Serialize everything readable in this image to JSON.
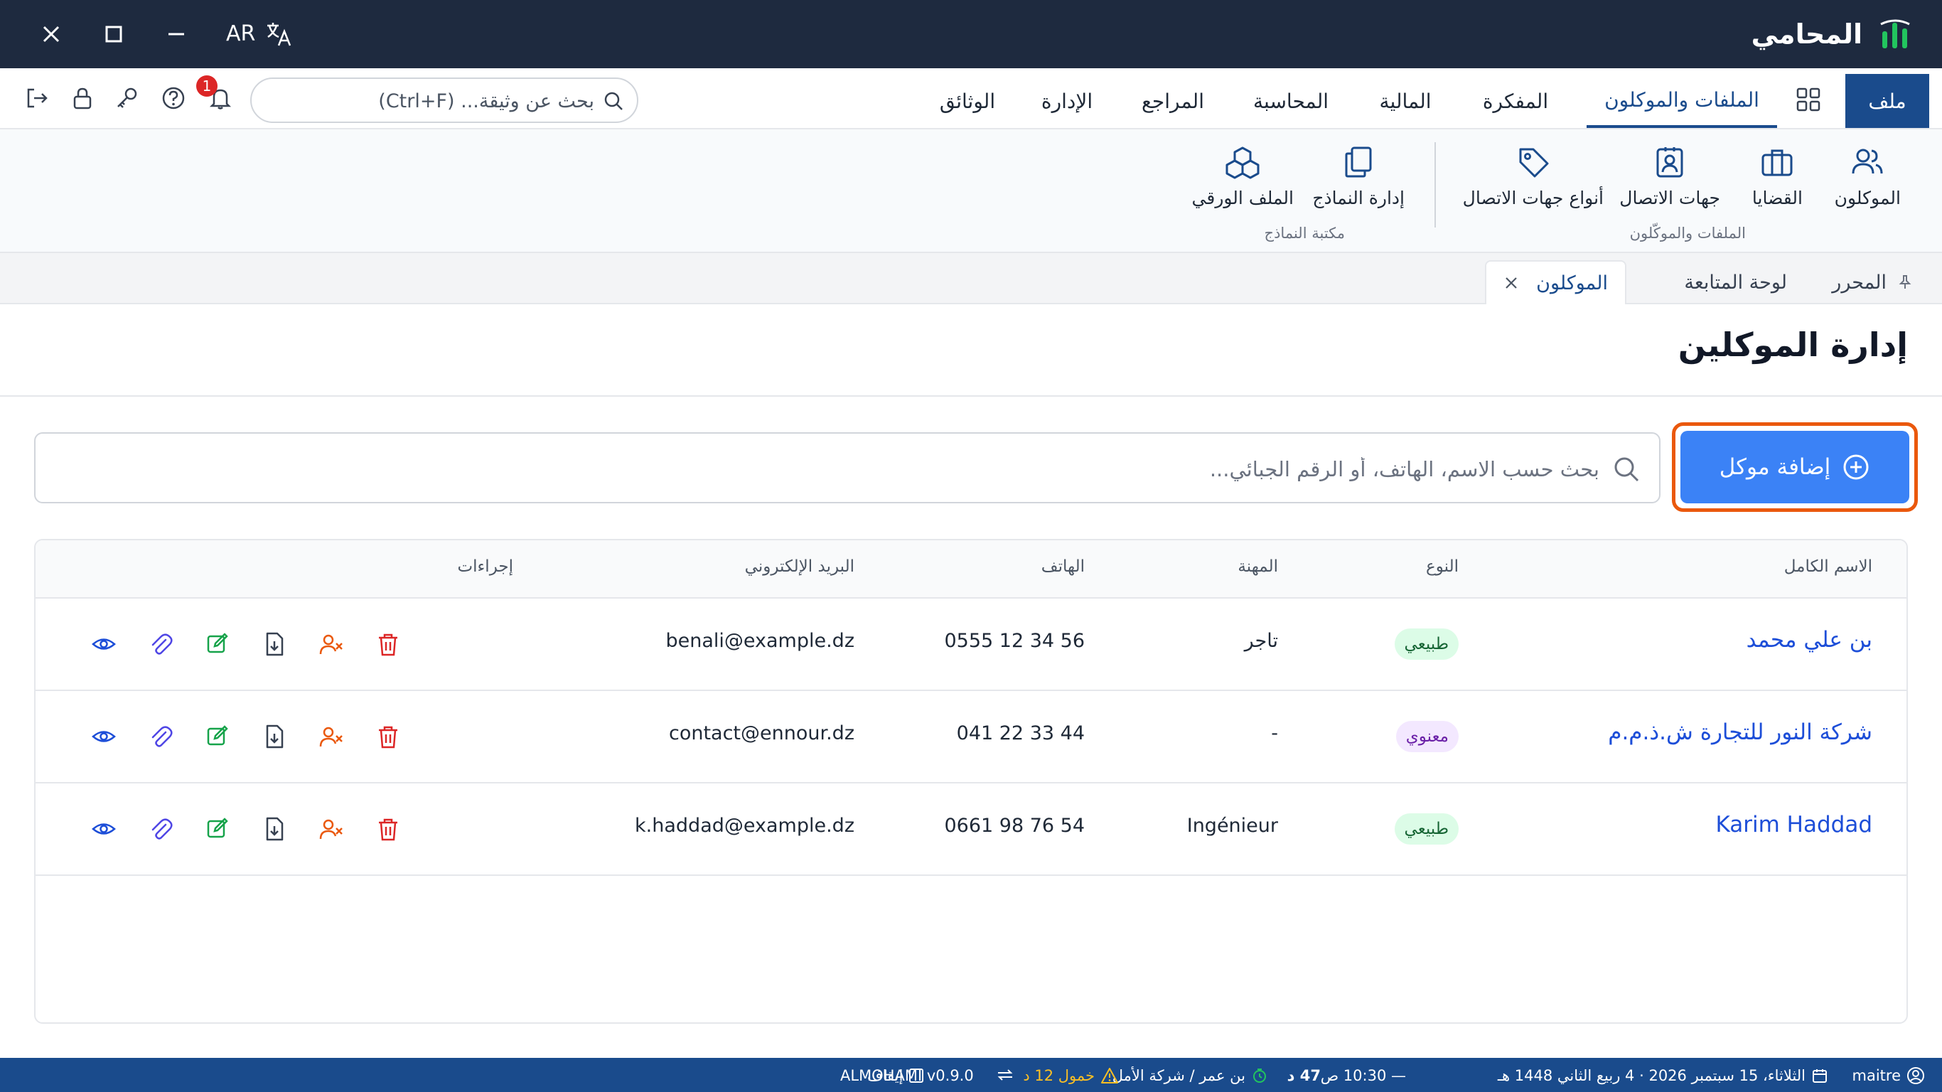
{
  "window": {
    "app_name": "المحامي",
    "lang_code": "AR"
  },
  "menu": {
    "file": "ملف",
    "tabs": [
      "الملفات والموكلون",
      "المفكرة",
      "المالية",
      "المحاسبة",
      "المراجع",
      "الإدارة",
      "الوثائق"
    ],
    "active_tab": "الملفات والموكلون",
    "search_placeholder": "بحث عن وثيقة... (Ctrl+F)",
    "notification_count": "1"
  },
  "ribbon": {
    "groups": [
      {
        "label": "الملفات والموكّلون",
        "items": [
          {
            "label": "الموكلون",
            "icon": "users-icon"
          },
          {
            "label": "القضايا",
            "icon": "briefcase-icon"
          },
          {
            "label": "جهات الاتصال",
            "icon": "contact-icon"
          },
          {
            "label": "أنواع جهات الاتصال",
            "icon": "tag-icon"
          }
        ]
      },
      {
        "label": "مكتبة النماذج",
        "items": [
          {
            "label": "إدارة النماذج",
            "icon": "copy-icon"
          },
          {
            "label": "الملف الورقي",
            "icon": "boxes-icon"
          }
        ]
      }
    ]
  },
  "doc_tabs": {
    "pinned": "المحرر",
    "dashboard": "لوحة المتابعة",
    "active": "الموكلون"
  },
  "page": {
    "title": "إدارة الموكلين",
    "add_button": "إضافة موكل",
    "search_placeholder": "بحث حسب الاسم، الهاتف، أو الرقم الجبائي..."
  },
  "table": {
    "headers": {
      "name": "الاسم الكامل",
      "type": "النوع",
      "profession": "المهنة",
      "phone": "الهاتف",
      "email": "البريد الإلكتروني",
      "actions": "إجراءات"
    },
    "rows": [
      {
        "name": "بن علي محمد",
        "type": "طبيعي",
        "type_kind": "natural",
        "profession": "تاجر",
        "phone": "0555 12 34 56",
        "email": "benali@example.dz"
      },
      {
        "name": "شركة النور للتجارة ش.ذ.م.م",
        "type": "معنوي",
        "type_kind": "moral",
        "profession": "-",
        "phone": "041 22 33 44",
        "email": "contact@ennour.dz"
      },
      {
        "name": "Karim Haddad",
        "type": "طبيعي",
        "type_kind": "natural",
        "profession": "Ingénieur",
        "phone": "0661 98 76 54",
        "email": "k.haddad@example.dz"
      }
    ],
    "action_icons": [
      "delete-icon",
      "unassign-user-icon",
      "download-icon",
      "edit-icon",
      "attachment-icon",
      "view-icon"
    ]
  },
  "status": {
    "user": "maitre",
    "date": "الثلاثاء، 15 سبتمبر 2026 · 4 ربيع الثاني 1448 هـ",
    "time": "— 10:30 ص",
    "duration": "47 د",
    "client_case": "بن عمر / شركة الأمل",
    "idle": "خمول 12 د",
    "pause": "إيقاف",
    "version": "ALMOHAMI v0.9.0"
  },
  "colors": {
    "titlebar": "#1e2a3f",
    "primary": "#1a4b8c",
    "accent_button": "#3b82f6",
    "highlight_ring": "#ea580c",
    "delete": "#dc2626",
    "unassign": "#ea580c",
    "edit": "#16a34a",
    "attach": "#4f46e5",
    "view": "#1d4ed8"
  }
}
